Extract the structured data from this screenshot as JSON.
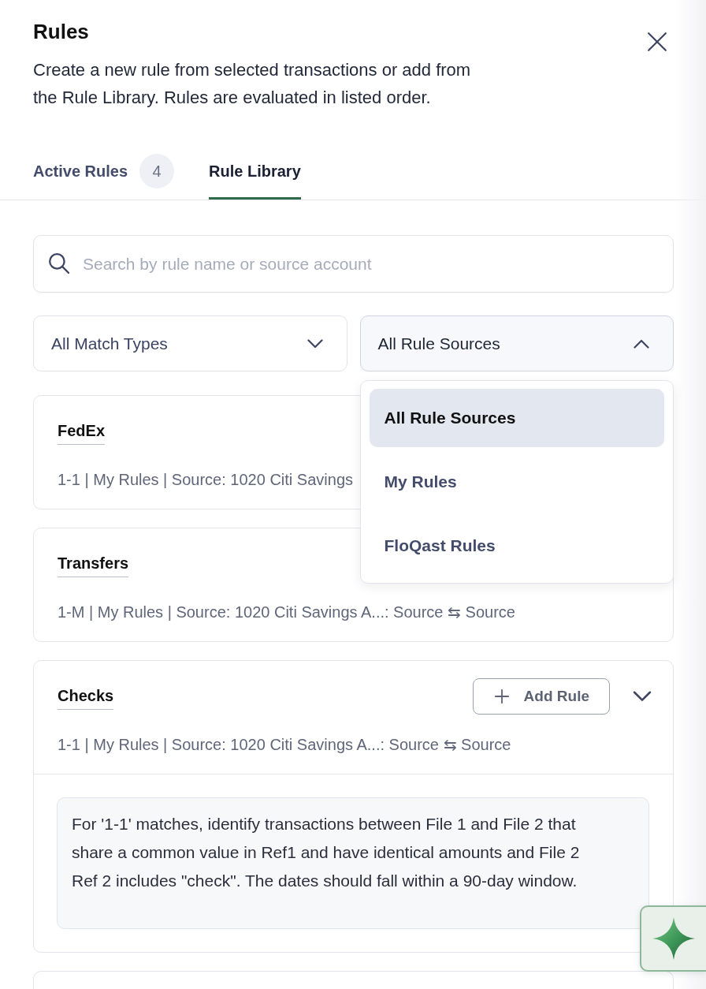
{
  "header": {
    "title": "Rules",
    "description": "Create a new rule from selected transactions or add from the Rule Library. Rules are evaluated in listed order."
  },
  "tabs": [
    {
      "label": "Active Rules",
      "badge": "4",
      "selected": false
    },
    {
      "label": "Rule Library",
      "selected": true
    }
  ],
  "search": {
    "placeholder": "Search by rule name or source account"
  },
  "filters": [
    {
      "label": "All Match Types",
      "open": false
    },
    {
      "label": "All Rule Sources",
      "open": true,
      "options": [
        {
          "label": "All Rule Sources",
          "selected": true
        },
        {
          "label": "My Rules",
          "selected": false
        },
        {
          "label": "FloQast Rules",
          "selected": false
        }
      ]
    }
  ],
  "rules": [
    {
      "kind": "rule",
      "name": "FedEx",
      "details": "1-1 | My Rules | Source: 1020 Citi Savings",
      "expanded": false
    },
    {
      "kind": "rule",
      "name": "Transfers",
      "details": "1-M | My Rules | Source: 1020 Citi Savings A...: Source ⇆ Source",
      "expanded": false
    },
    {
      "kind": "rule",
      "name": "Checks",
      "details": "1-1 | My Rules | Source: 1020 Citi Savings A...: Source ⇆ Source",
      "action": "Add Rule",
      "expanded": true,
      "description": "For '1-1' matches, identify transactions between File 1 and File 2 that share a common value in Ref1 and have identical amounts and File 2 Ref 2 includes \"check\". The dates should fall within a 90-day window."
    },
    {
      "kind": "clipped"
    }
  ]
}
